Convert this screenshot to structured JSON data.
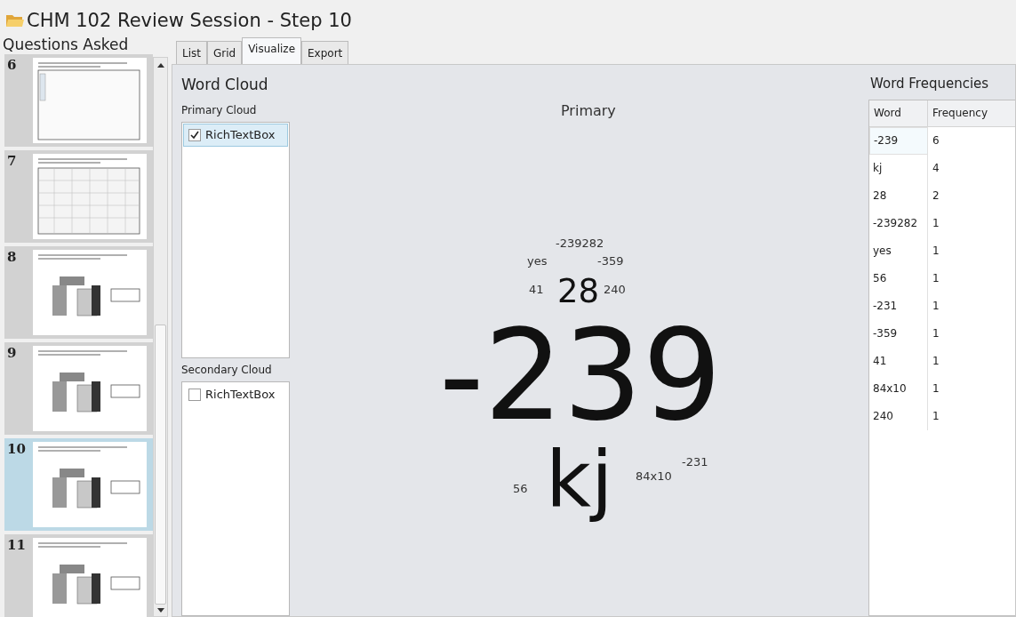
{
  "window": {
    "title": "CHM 102 Review Session - Step 10"
  },
  "questions": {
    "title": "Questions Asked",
    "items": [
      {
        "number": "6",
        "selected": false
      },
      {
        "number": "7",
        "selected": false
      },
      {
        "number": "8",
        "selected": false
      },
      {
        "number": "9",
        "selected": false
      },
      {
        "number": "10",
        "selected": true
      },
      {
        "number": "11",
        "selected": false
      }
    ]
  },
  "tabs": [
    {
      "label": "List",
      "selected": false
    },
    {
      "label": "Grid",
      "selected": false
    },
    {
      "label": "Visualize",
      "selected": true
    },
    {
      "label": "Export",
      "selected": false
    }
  ],
  "word_cloud": {
    "title": "Word Cloud",
    "primary_label": "Primary Cloud",
    "primary_items": [
      {
        "label": "RichTextBox",
        "checked": true,
        "selected": true
      }
    ],
    "secondary_label": "Secondary Cloud",
    "secondary_items": [
      {
        "label": "RichTextBox",
        "checked": false,
        "selected": false
      }
    ],
    "cloud_title": "Primary",
    "words": [
      {
        "text": "-239282",
        "kind": "small"
      },
      {
        "text": "yes",
        "kind": "small"
      },
      {
        "text": "-359",
        "kind": "small"
      },
      {
        "text": "41",
        "kind": "small"
      },
      {
        "text": "28",
        "kind": "medium"
      },
      {
        "text": "240",
        "kind": "small"
      },
      {
        "text": "-239",
        "kind": "huge"
      },
      {
        "text": "kj",
        "kind": "large"
      },
      {
        "text": "-231",
        "kind": "small"
      },
      {
        "text": "84x10",
        "kind": "small"
      },
      {
        "text": "56",
        "kind": "small"
      }
    ]
  },
  "frequencies": {
    "title": "Word Frequencies",
    "columns": [
      "Word",
      "Frequency"
    ],
    "rows": [
      {
        "word": "-239",
        "frequency": "6",
        "selected": true
      },
      {
        "word": "kj",
        "frequency": "4",
        "selected": false
      },
      {
        "word": "28",
        "frequency": "2",
        "selected": false
      },
      {
        "word": "-239282",
        "frequency": "1",
        "selected": false
      },
      {
        "word": "yes",
        "frequency": "1",
        "selected": false
      },
      {
        "word": "56",
        "frequency": "1",
        "selected": false
      },
      {
        "word": "-231",
        "frequency": "1",
        "selected": false
      },
      {
        "word": "-359",
        "frequency": "1",
        "selected": false
      },
      {
        "word": "41",
        "frequency": "1",
        "selected": false
      },
      {
        "word": "84x10",
        "frequency": "1",
        "selected": false
      },
      {
        "word": "240",
        "frequency": "1",
        "selected": false
      }
    ]
  }
}
